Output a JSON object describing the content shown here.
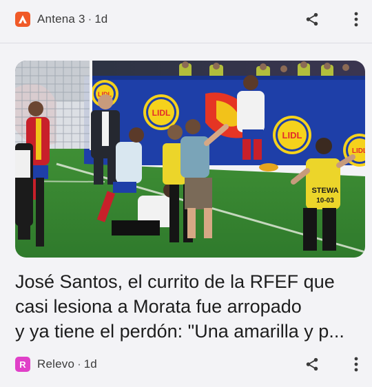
{
  "top_card": {
    "source": "Antena 3",
    "separator": "·",
    "age": "1d",
    "logo_color": "#f05a28",
    "logo_icon": "antena3-logo-icon",
    "share_icon": "share-icon",
    "menu_icon": "more-vert-icon"
  },
  "article": {
    "headline_lines": [
      "José Santos, el currito de la RFEF que",
      "casi lesiona a Morata fue arropado",
      "y ya tiene el perdón: \"Una amarilla y p..."
    ],
    "image_sign_1": "LIDL",
    "image_sign_2": "LIDL",
    "image_sign_3": "LIDL",
    "image_sign_4": "LIDL",
    "image_steward_text": "STEWA\n10-03",
    "source": "Relevo",
    "separator": "·",
    "age": "1d",
    "logo_color": "#e040c8",
    "logo_text": "R",
    "share_icon": "share-icon",
    "menu_icon": "more-vert-icon"
  }
}
